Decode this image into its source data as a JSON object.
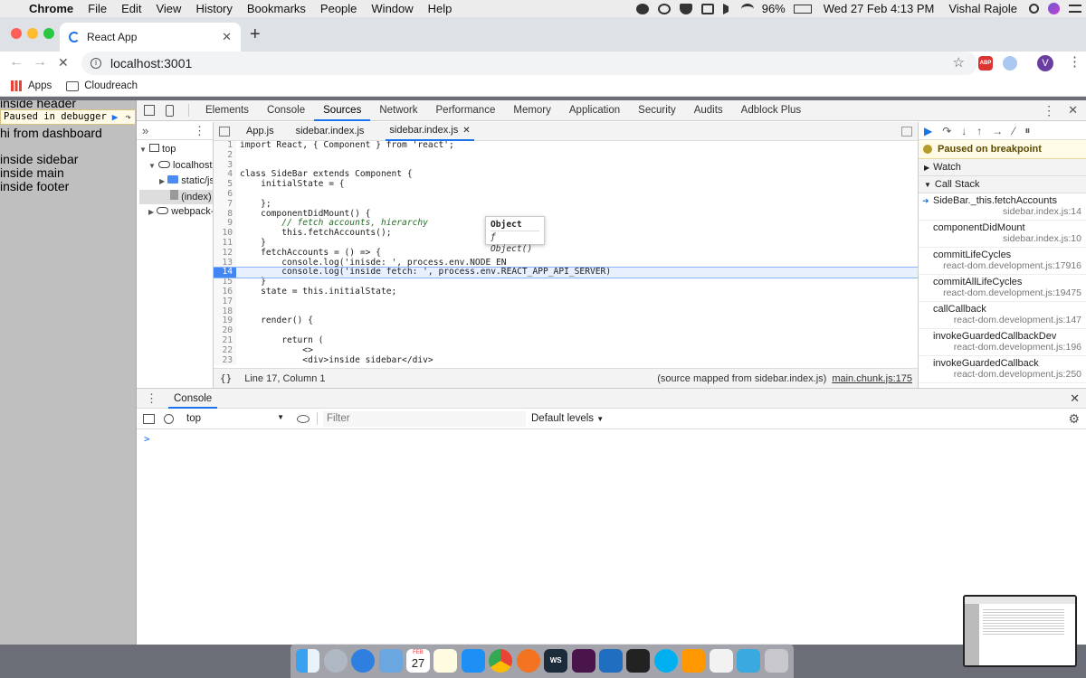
{
  "menubar": {
    "app_name": "Chrome",
    "items": [
      "File",
      "Edit",
      "View",
      "History",
      "Bookmarks",
      "People",
      "Window",
      "Help"
    ],
    "battery": "96%",
    "clock": "Wed 27 Feb  4:13 PM",
    "user": "Vishal Rajole"
  },
  "browser": {
    "tab_title": "React App",
    "url": "localhost:3001",
    "profile_initial": "V",
    "abp_label": "ABP",
    "bookmarks": [
      "Apps",
      "Cloudreach"
    ]
  },
  "page": {
    "overlay_text": "Paused in debugger",
    "lines": [
      "inside header",
      "hi from dashboard",
      "",
      "inside sidebar",
      "inside main",
      "inside footer"
    ]
  },
  "devtools": {
    "tabs": [
      "Elements",
      "Console",
      "Sources",
      "Network",
      "Performance",
      "Memory",
      "Application",
      "Security",
      "Audits",
      "Adblock Plus"
    ],
    "active_tab": "Sources",
    "navigator": [
      "top",
      "localhost:",
      "static/js",
      "(index)",
      "webpack-"
    ],
    "file_tabs": [
      "App.js",
      "sidebar.index.js",
      "sidebar.index.js"
    ],
    "active_file": "sidebar.index.js",
    "code_lines": [
      {
        "n": "1",
        "t": "import React, { Component } from 'react';"
      },
      {
        "n": "2",
        "t": ""
      },
      {
        "n": "3",
        "t": ""
      },
      {
        "n": "4",
        "t": "class SideBar extends Component {"
      },
      {
        "n": "5",
        "t": "    initialState = {"
      },
      {
        "n": "6",
        "t": ""
      },
      {
        "n": "7",
        "t": "    };"
      },
      {
        "n": "8",
        "t": "    componentDidMount() {"
      },
      {
        "n": "9",
        "t": "        // fetch accounts, hierarchy"
      },
      {
        "n": "10",
        "t": "        this.fetchAccounts();"
      },
      {
        "n": "11",
        "t": "    }"
      },
      {
        "n": "12",
        "t": "    fetchAccounts = () => {"
      },
      {
        "n": "13",
        "t": "        console.log('inisde: ', process.env.NODE_EN"
      },
      {
        "n": "14",
        "t": "        console.log('inside fetch: ', process.env.REACT_APP_API_SERVER)"
      },
      {
        "n": "15",
        "t": "    }"
      },
      {
        "n": "16",
        "t": "    state = this.initialState;"
      },
      {
        "n": "17",
        "t": ""
      },
      {
        "n": "18",
        "t": ""
      },
      {
        "n": "19",
        "t": "    render() {"
      },
      {
        "n": "20",
        "t": ""
      },
      {
        "n": "21",
        "t": "        return ("
      },
      {
        "n": "22",
        "t": "            <>"
      },
      {
        "n": "23",
        "t": "            <div>inside sidebar</div>"
      }
    ],
    "tooltip_title": "Object",
    "tooltip_value": "ƒ Object()",
    "status_position": "Line 17, Column 1",
    "status_mapped": "(source mapped from sidebar.index.js)",
    "status_link": "main.chunk.js:175",
    "paused_label": "Paused on breakpoint",
    "watch_label": "Watch",
    "callstack_label": "Call Stack",
    "call_stack": [
      {
        "fn": "SideBar._this.fetchAccounts",
        "loc": "sidebar.index.js:14"
      },
      {
        "fn": "componentDidMount",
        "loc": "sidebar.index.js:10"
      },
      {
        "fn": "commitLifeCycles",
        "loc": "react-dom.development.js:17916"
      },
      {
        "fn": "commitAllLifeCycles",
        "loc": "react-dom.development.js:19475"
      },
      {
        "fn": "callCallback",
        "loc": "react-dom.development.js:147"
      },
      {
        "fn": "invokeGuardedCallbackDev",
        "loc": "react-dom.development.js:196"
      },
      {
        "fn": "invokeGuardedCallback",
        "loc": "react-dom.development.js:250"
      }
    ],
    "drawer_title": "Console",
    "context": "top",
    "filter_placeholder": "Filter",
    "levels": "Default levels",
    "prompt": ">"
  },
  "dock": {
    "calendar_month": "FEB",
    "calendar_day": "27",
    "ws_label": "WS"
  },
  "colors": {
    "accent": "#1a73e8",
    "paused_bg": "#fffbe6",
    "breakpoint": "#4285f4"
  }
}
